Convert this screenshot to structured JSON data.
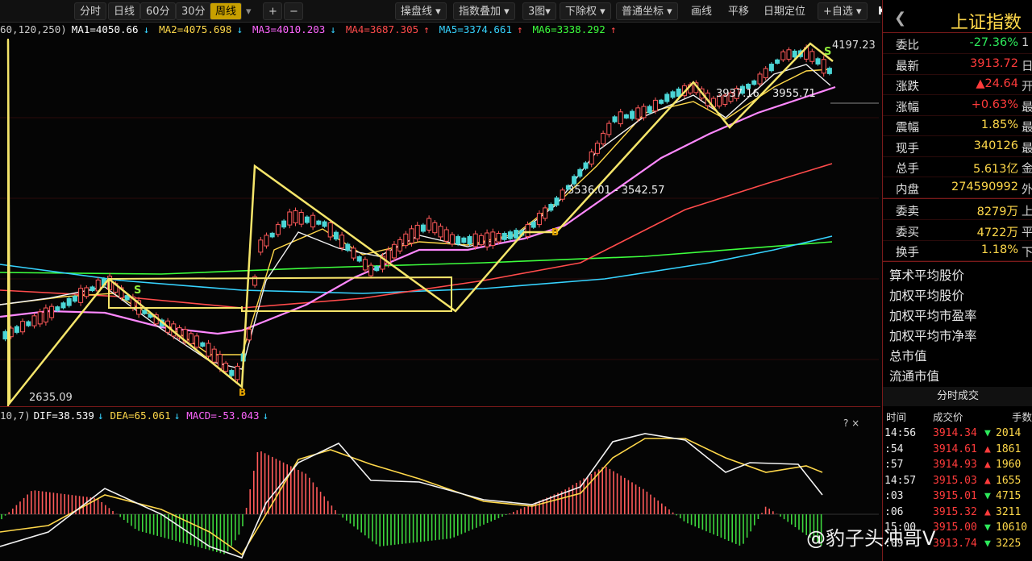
{
  "toolbar": {
    "items": [
      "分时",
      "日线",
      "60分",
      "30分",
      "周线"
    ],
    "active": "周线",
    "zoom_in": "+",
    "zoom_out": "−",
    "menus": [
      "操盘线",
      "指数叠加",
      "3图",
      "下除权",
      "普通坐标",
      "画线",
      "平移",
      "日期定位",
      "+自选"
    ],
    "more": "K"
  },
  "ma_line": {
    "params": "60,120,250)",
    "ma1": "MA1=4050.66",
    "ma2": "MA2=4075.698",
    "ma3": "MA3=4010.203",
    "ma4": "MA4=3687.305",
    "ma5": "MA5=3374.661",
    "ma6": "MA6=3338.292",
    "arrows": [
      "↓",
      "↓",
      "↓",
      "↑",
      "↑",
      "↑"
    ],
    "colors": {
      "ma1": "#ffffff",
      "ma2": "#ffd84a",
      "ma3": "#ff66ff",
      "ma4": "#ff4b4b",
      "ma5": "#36d3ff",
      "ma6": "#3dff3d"
    }
  },
  "chart_labels": {
    "high": "4197.23",
    "low": "2635.09",
    "mid1": "3937.16",
    "mid2": "3955.71",
    "range": "3536.01 - 3542.57",
    "s_mark": "S",
    "b_mark": "B"
  },
  "macd_line": {
    "params": "10,7)",
    "dif": "DIF=38.539",
    "dea": "DEA=65.061",
    "macd": "MACD=-53.043",
    "arrows": [
      "↓",
      "↓",
      "↓"
    ],
    "corner": "? ×"
  },
  "panel": {
    "title": "上证指数",
    "back": "❮",
    "rows": [
      {
        "k": "委比",
        "v": "-27.36%",
        "c": "green",
        "x": "1"
      },
      {
        "k": "最新",
        "v": "3913.72",
        "c": "red",
        "x": "日"
      },
      {
        "k": "涨跌",
        "v": "▲24.64",
        "c": "red",
        "x": "开"
      },
      {
        "k": "涨幅",
        "v": "+0.63%",
        "c": "red",
        "x": "最"
      },
      {
        "k": "震幅",
        "v": "1.85%",
        "c": "yellow",
        "x": "最"
      },
      {
        "k": "现手",
        "v": "340126",
        "c": "yellow",
        "x": "最"
      },
      {
        "k": "总手",
        "v": "5.613亿",
        "c": "yellow",
        "x": "金"
      },
      {
        "k": "内盘",
        "v": "274590992",
        "c": "yellow",
        "x": "外"
      }
    ],
    "rows2": [
      {
        "k": "委卖",
        "v": "8279万",
        "c": "yellow",
        "x": "上"
      },
      {
        "k": "委买",
        "v": "4722万",
        "c": "yellow",
        "x": "平"
      },
      {
        "k": "换手",
        "v": "1.18%",
        "c": "yellow",
        "x": "下"
      }
    ],
    "stats": [
      "算术平均股价",
      "加权平均股价",
      "加权平均市盈率",
      "加权平均市净率",
      "总市值",
      "流通市值"
    ],
    "tick_title": "分时成交",
    "tick_cols": [
      "时间",
      "成交价",
      "手数"
    ],
    "ticks": [
      {
        "t": "14:56",
        "p": "3914.34",
        "a": "▼",
        "ac": "green",
        "n": "2014"
      },
      {
        "t": "  :54",
        "p": "3914.61",
        "a": "▲",
        "ac": "red",
        "n": "1861"
      },
      {
        "t": "  :57",
        "p": "3914.93",
        "a": "▲",
        "ac": "red",
        "n": "1960"
      },
      {
        "t": "14:57",
        "p": "3915.03",
        "a": "▲",
        "ac": "red",
        "n": "1655"
      },
      {
        "t": "  :03",
        "p": "3915.01",
        "a": "▼",
        "ac": "green",
        "n": "4715"
      },
      {
        "t": "  :06",
        "p": "3915.32",
        "a": "▲",
        "ac": "red",
        "n": "3211"
      },
      {
        "t": "15:00",
        "p": "3915.00",
        "a": "▼",
        "ac": "green",
        "n": "10610"
      },
      {
        "t": "  :09",
        "p": "3913.74",
        "a": "▼",
        "ac": "green",
        "n": "3225"
      }
    ]
  },
  "watermark": "@豹子头冲哥V"
}
